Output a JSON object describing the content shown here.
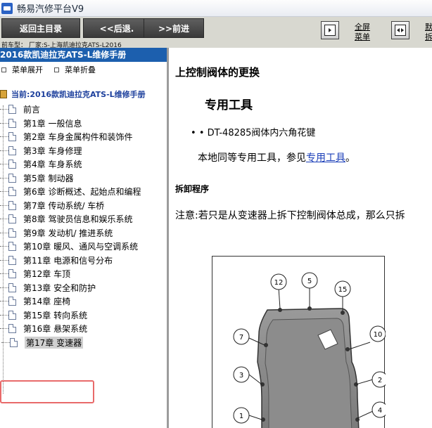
{
  "window": {
    "title": "畅易汽修平台V9"
  },
  "toolbar": {
    "home_label": "返回主目录",
    "back_label": "<<后退.",
    "forward_label": ">>前进",
    "fullscreen_label_1": "全屏",
    "fullscreen_label_2": "菜单",
    "second_label_1": "默",
    "second_label_2": "拆",
    "vehicle_text": "前车型： 厂家:S-上海凯迪拉克ATS-L2016"
  },
  "sidebar": {
    "header": "2016款凯迪拉克ATS-L维修手册",
    "expand_label": "菜单展开",
    "collapse_label": "菜单折叠",
    "root_label": "当前:2016款凯迪拉克ATS-L维修手册",
    "items": [
      "前言",
      "第1章 一般信息",
      "第2章 车身金属构件和装饰件",
      "第3章 车身修理",
      "第4章 车身系统",
      "第5章 制动器",
      "第6章 诊断概述、起始点和编程",
      "第7章 传动系统/ 车桥",
      "第8章 驾驶员信息和娱乐系统",
      "第9章 发动机/ 推进系统",
      "第10章 暖风、通风与空调系统",
      "第11章 电源和信号分布",
      "第12章 车顶",
      "第13章 安全和防护",
      "第14章 座椅",
      "第15章 转向系统",
      "第16章 悬架系统",
      "第17章 变速器"
    ]
  },
  "content": {
    "title": "上控制阀体的更换",
    "tools_heading": "专用工具",
    "tool_item": "• DT-48285阀体内六角花键",
    "local_tools_prefix": "本地同等专用工具，参见",
    "local_tools_link": "专用工具",
    "local_tools_suffix": "。",
    "removal_heading": "拆卸程序",
    "note": "注意:若只是从变速器上拆下控制阀体总成，那么只拆",
    "callouts": [
      "12",
      "5",
      "15",
      "7",
      "10",
      "3",
      "2",
      "1",
      "4"
    ]
  }
}
